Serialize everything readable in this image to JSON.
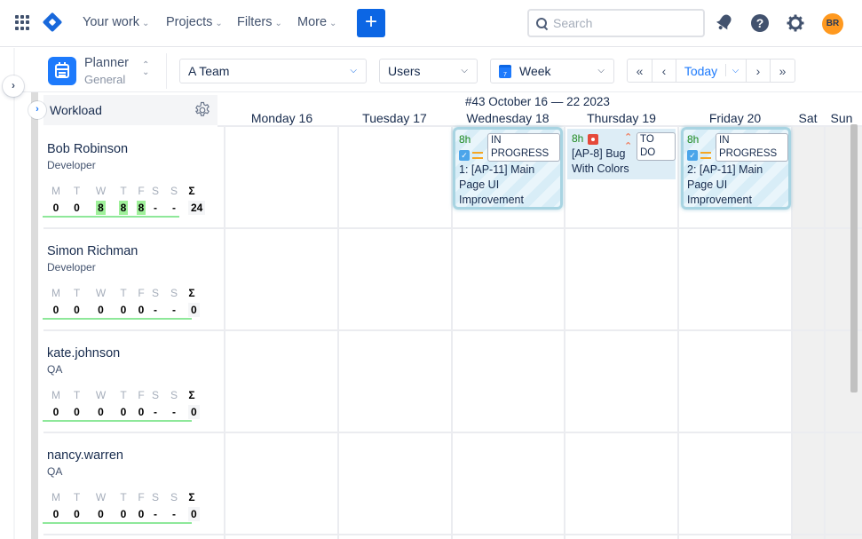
{
  "topnav": {
    "links": [
      {
        "label": "Your work"
      },
      {
        "label": "Projects"
      },
      {
        "label": "Filters"
      },
      {
        "label": "More"
      }
    ],
    "create_label": "+",
    "search_placeholder": "Search",
    "avatar_initials": "BR",
    "help_glyph": "?",
    "icons": [
      "apps-grid-icon",
      "jira-logo-icon",
      "search-icon",
      "notifications-bell-icon",
      "help-icon",
      "settings-gear-icon"
    ]
  },
  "toolbar": {
    "app_title": "Planner",
    "app_subtitle": "General",
    "team_select": "A Team",
    "group_select": "Users",
    "view_select": "Week",
    "view_icon_day": "7",
    "today_label": "Today",
    "nav": {
      "first": "«",
      "prev": "‹",
      "next": "›",
      "last": "»",
      "dropdown": "⌄"
    }
  },
  "calendar": {
    "week_label": "#43 October 16 — 22 2023",
    "days": [
      {
        "label": "Monday 16"
      },
      {
        "label": "Tuesday 17"
      },
      {
        "label": "Wednesday 18"
      },
      {
        "label": "Thursday 19"
      },
      {
        "label": "Friday 20"
      },
      {
        "label": "Sat"
      },
      {
        "label": "Sun"
      }
    ]
  },
  "workload": {
    "title": "Workload",
    "day_letters": [
      "M",
      "T",
      "W",
      "T",
      "F",
      "S",
      "S"
    ],
    "sum_symbol": "Σ",
    "users": [
      {
        "name": "Bob Robinson",
        "role": "Developer",
        "values": [
          "0",
          "0",
          "8",
          "8",
          "8",
          "-",
          "-"
        ],
        "highlight": [
          false,
          false,
          true,
          true,
          true,
          false,
          false
        ],
        "total": "24"
      },
      {
        "name": "Simon Richman",
        "role": "Developer",
        "values": [
          "0",
          "0",
          "0",
          "0",
          "0",
          "-",
          "-"
        ],
        "highlight": [
          false,
          false,
          false,
          false,
          false,
          false,
          false
        ],
        "total": "0"
      },
      {
        "name": "kate.johnson",
        "role": "QA",
        "values": [
          "0",
          "0",
          "0",
          "0",
          "0",
          "-",
          "-"
        ],
        "highlight": [
          false,
          false,
          false,
          false,
          false,
          false,
          false
        ],
        "total": "0"
      },
      {
        "name": "nancy.warren",
        "role": "QA",
        "values": [
          "0",
          "0",
          "0",
          "0",
          "0",
          "-",
          "-"
        ],
        "highlight": [
          false,
          false,
          false,
          false,
          false,
          false,
          false
        ],
        "total": "0"
      }
    ]
  },
  "cards": [
    {
      "user": "Bob Robinson",
      "day": "Wednesday 18",
      "hours": "8h",
      "status": "IN PROGRESS",
      "type": "task",
      "priority": "medium",
      "title_lines": [
        "1: [AP-11] Main",
        "Page UI",
        "Improvement"
      ]
    },
    {
      "user": "Bob Robinson",
      "day": "Thursday 19",
      "hours": "8h",
      "status": "TO DO",
      "type": "bug",
      "priority": "high",
      "title_lines": [
        "[AP-8] Bug",
        "With Colors"
      ]
    },
    {
      "user": "Bob Robinson",
      "day": "Friday 20",
      "hours": "8h",
      "status": "IN PROGRESS",
      "type": "task",
      "priority": "medium",
      "title_lines": [
        "2: [AP-11] Main",
        "Page UI",
        "Improvement"
      ]
    }
  ],
  "colors": {
    "accent": "#0c66e4",
    "avatar": "#ff991f",
    "workload_highlight": "#9ff09a",
    "card_border": "#a8d4e2",
    "bug": "#e5493a",
    "medium_priority": "#f5a623"
  }
}
